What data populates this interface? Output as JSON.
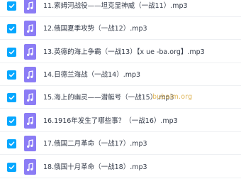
{
  "files": [
    {
      "name": "11.索姆河战役——坦克显神威（一战11）.mp3",
      "checked": true,
      "icon": "music-file-icon"
    },
    {
      "name": "12.俄国夏季攻势（一战12）.mp3",
      "checked": true,
      "icon": "music-file-icon"
    },
    {
      "name": "13.英德的海上争霸（一战13）【x ue -ba.org】.mp3",
      "checked": true,
      "icon": "music-file-icon"
    },
    {
      "name": "14.日德兰海战（一战14）.mp3",
      "checked": true,
      "icon": "music-file-icon"
    },
    {
      "name": "15.海上的幽灵——潜艇号（一战15）.mp3",
      "checked": true,
      "icon": "music-file-icon"
    },
    {
      "name": "16.1916年发生了哪些事？（一战16）.mp3",
      "checked": true,
      "icon": "music-file-icon"
    },
    {
      "name": "17.俄国二月革命（一战17）.mp3",
      "checked": true,
      "icon": "music-file-icon"
    },
    {
      "name": "18.俄国十月革命（一战18）.mp3",
      "checked": true,
      "icon": "music-file-icon"
    }
  ],
  "watermark": "bubaim.org",
  "colors": {
    "checkbox": "#06a7ff",
    "file_icon": "#8b7cf5",
    "text": "#333a48",
    "divider": "#eef0f3"
  }
}
